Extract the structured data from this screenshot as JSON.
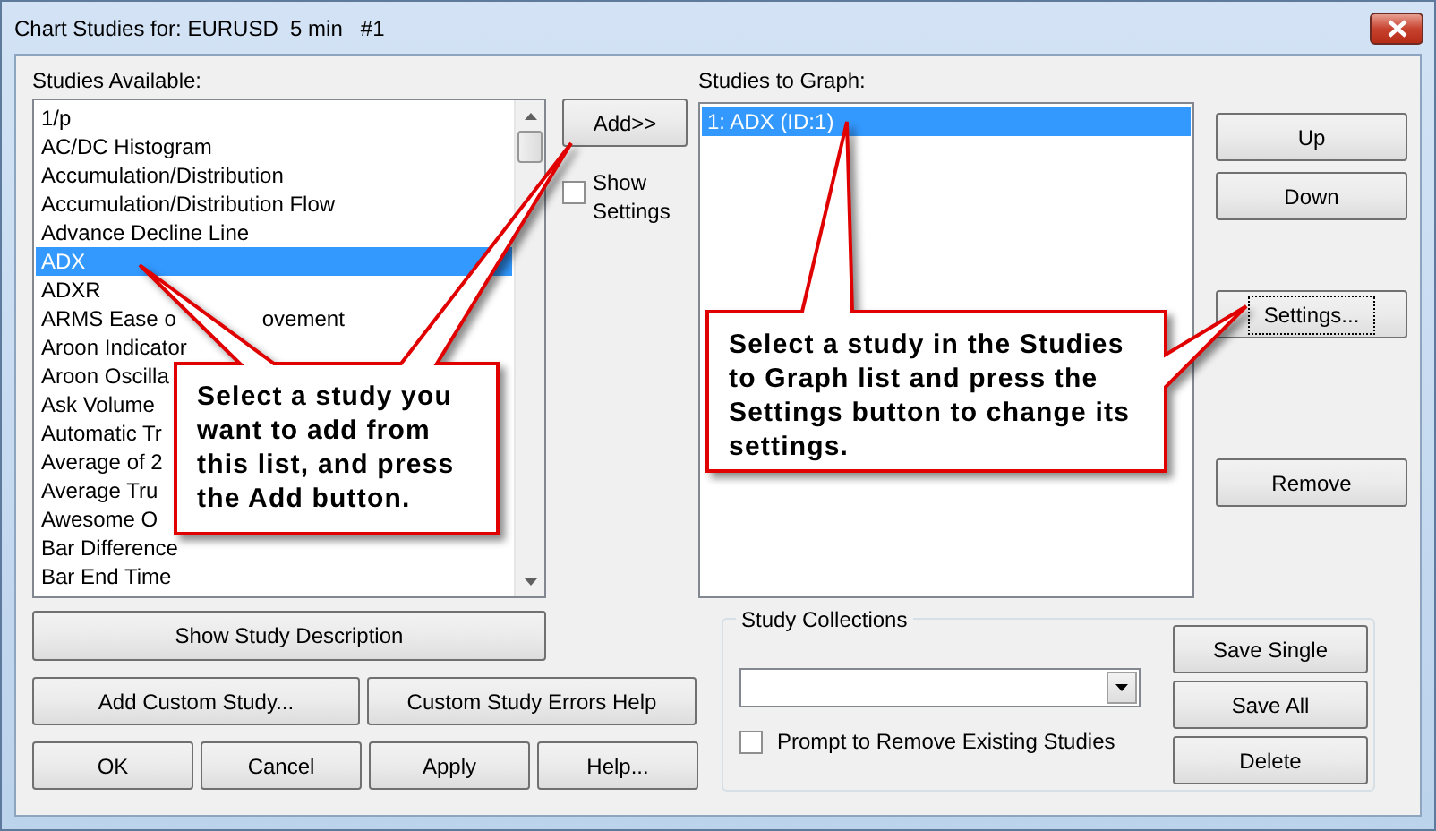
{
  "window": {
    "title": "Chart Studies for: EURUSD  5 min   #1"
  },
  "studies_available": {
    "label": "Studies Available:",
    "items": [
      {
        "text": "1/p",
        "selected": false
      },
      {
        "text": "AC/DC Histogram",
        "selected": false
      },
      {
        "text": "Accumulation/Distribution",
        "selected": false
      },
      {
        "text": "Accumulation/Distribution Flow",
        "selected": false
      },
      {
        "text": "Advance Decline Line",
        "selected": false
      },
      {
        "text": "ADX",
        "selected": true
      },
      {
        "text": "ADXR",
        "selected": false
      },
      {
        "text_parts": [
          "ARMS Ease o",
          "ovement"
        ],
        "selected": false
      },
      {
        "text": "Aroon Indicator",
        "selected": false
      },
      {
        "text": "Aroon Oscilla",
        "selected": false
      },
      {
        "text": "Ask Volume",
        "selected": false
      },
      {
        "text": "Automatic Tr",
        "selected": false
      },
      {
        "text": "Average of 2",
        "selected": false
      },
      {
        "text": "Average Tru",
        "selected": false
      },
      {
        "text": "Awesome O",
        "selected": false
      },
      {
        "text": "Bar Difference",
        "selected": false
      },
      {
        "text": "Bar End Time",
        "selected": false
      }
    ]
  },
  "add_button": "Add>>",
  "show_settings": {
    "label": "Show Settings",
    "checked": false
  },
  "studies_to_graph": {
    "label": "Studies to Graph:",
    "items": [
      {
        "text": "1: ADX (ID:1)",
        "selected": true
      }
    ]
  },
  "side_buttons": [
    {
      "label": "Up",
      "focused": false
    },
    {
      "label": "Down",
      "focused": false
    },
    {
      "label": "Settings...",
      "focused": true
    },
    {
      "label": "Remove",
      "focused": false
    }
  ],
  "footer_buttons": {
    "description": "Show Study Description",
    "custom": [
      "Add Custom Study...",
      "Custom Study Errors Help"
    ],
    "actions": [
      "OK",
      "Cancel",
      "Apply",
      "Help..."
    ]
  },
  "study_collections": {
    "title": "Study Collections",
    "prompt": {
      "label": "Prompt to Remove Existing Studies",
      "checked": false
    },
    "buttons": [
      "Save Single",
      "Save All",
      "Delete"
    ]
  },
  "callouts": [
    {
      "text": "Select a study you want to add from this list, and press the Add button."
    },
    {
      "text": "Select a study in the Studies to Graph list and press the Settings button to change its settings."
    }
  ]
}
